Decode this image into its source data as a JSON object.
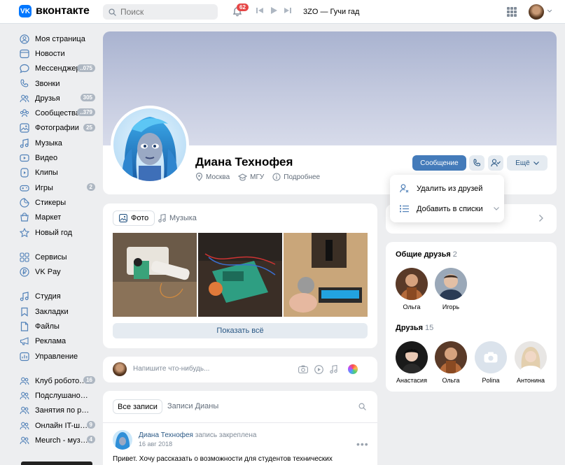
{
  "header": {
    "logo_text": "вконтакте",
    "logo_mark": "VK",
    "search_placeholder": "Поиск",
    "notifications_count": "62",
    "now_playing": "3ZO — Гучи гад"
  },
  "sidebar": {
    "groups": [
      [
        {
          "label": "Моя страница",
          "icon": "user-circle-icon"
        },
        {
          "label": "Новости",
          "icon": "news-icon"
        },
        {
          "label": "Мессенджер",
          "icon": "message-icon",
          "count": "..075"
        },
        {
          "label": "Звонки",
          "icon": "phone-icon"
        },
        {
          "label": "Друзья",
          "icon": "friends-icon",
          "count": "305"
        },
        {
          "label": "Сообщества",
          "icon": "communities-icon",
          "count": "..379"
        },
        {
          "label": "Фотографии",
          "icon": "photo-icon",
          "count": "25"
        },
        {
          "label": "Музыка",
          "icon": "music-icon"
        },
        {
          "label": "Видео",
          "icon": "video-icon"
        },
        {
          "label": "Клипы",
          "icon": "clips-icon"
        },
        {
          "label": "Игры",
          "icon": "games-icon",
          "count": "2"
        },
        {
          "label": "Стикеры",
          "icon": "sticker-icon"
        },
        {
          "label": "Маркет",
          "icon": "market-icon"
        },
        {
          "label": "Новый год",
          "icon": "star-icon"
        }
      ],
      [
        {
          "label": "Сервисы",
          "icon": "services-icon"
        },
        {
          "label": "VK Pay",
          "icon": "pay-icon"
        }
      ],
      [
        {
          "label": "Студия",
          "icon": "studio-icon"
        },
        {
          "label": "Закладки",
          "icon": "bookmark-icon"
        },
        {
          "label": "Файлы",
          "icon": "files-icon"
        },
        {
          "label": "Реклама",
          "icon": "ads-icon"
        },
        {
          "label": "Управление",
          "icon": "manage-icon"
        }
      ],
      [
        {
          "label": "Клуб робототехники",
          "icon": "group-icon",
          "count": "16"
        },
        {
          "label": "Подслушано в Роботех",
          "icon": "group-icon"
        },
        {
          "label": "Занятия по робототехнике",
          "icon": "group-icon"
        },
        {
          "label": "Онлайн IT-школа",
          "icon": "group-icon",
          "count": "9"
        },
        {
          "label": "Meurch - музыка",
          "icon": "group-icon",
          "count": "4"
        }
      ]
    ]
  },
  "profile": {
    "name": "Диана Технофея",
    "city": "Москва",
    "university": "МГУ",
    "details_link": "Подробнее",
    "message_button": "Сообщение",
    "more_button": "Ещё"
  },
  "dropdown": {
    "remove_friend": "Удалить из друзей",
    "add_to_lists": "Добавить в списки"
  },
  "media": {
    "tab_photo": "Фото",
    "tab_music": "Музыка",
    "show_all": "Показать всё"
  },
  "composer": {
    "placeholder": "Напишите что-нибудь..."
  },
  "wall": {
    "tab_all": "Все записи",
    "tab_hers": "Записи Дианы",
    "post": {
      "author": "Диана Технофея",
      "action": "запись закреплена",
      "date": "16 авг 2018",
      "text": "Привет. Хочу рассказать о возможности для студентов технических"
    }
  },
  "friends": {
    "mutual_title": "Общие друзья",
    "mutual_count": "2",
    "mutual": [
      "Ольга",
      "Игорь"
    ],
    "all_title": "Друзья",
    "all_count": "15",
    "all": [
      "Анастасия",
      "Ольга",
      "Polina",
      "Антонина"
    ]
  },
  "colors": {
    "accent": "#447bba",
    "link": "#2a5885",
    "badge": "#e64646"
  }
}
